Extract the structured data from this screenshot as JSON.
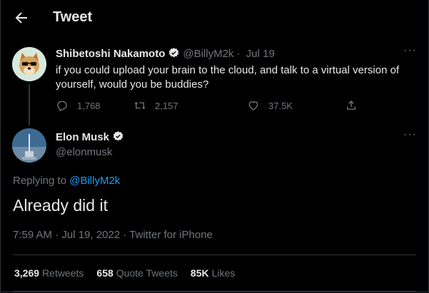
{
  "header": {
    "title": "Tweet"
  },
  "parent_tweet": {
    "author_name": "Shibetoshi Nakamoto",
    "handle": "@BillyM2k",
    "separator": "·",
    "date": "Jul 19",
    "text": "if you could upload your brain to the cloud, and talk to a virtual version of yourself, would you be buddies?",
    "replies": "1,768",
    "retweets": "2,157",
    "likes": "37.5K"
  },
  "main_tweet": {
    "author_name": "Elon Musk",
    "handle": "@elonmusk",
    "replying_prefix": "Replying to ",
    "replying_to": "@BillyM2k",
    "text": "Already did it",
    "meta": "7:59 AM · Jul 19, 2022 · Twitter for iPhone"
  },
  "stats": {
    "retweets_count": "3,269",
    "retweets_label": "Retweets",
    "quotes_count": "658",
    "quotes_label": "Quote Tweets",
    "likes_count": "85K",
    "likes_label": "Likes"
  },
  "more_glyph": "···",
  "colors": {
    "background": "#000000",
    "text": "#e7e9ea",
    "muted": "#71767b",
    "accent": "#1d9bf0",
    "border": "#2f3336",
    "verified": "#e7e9ea"
  }
}
